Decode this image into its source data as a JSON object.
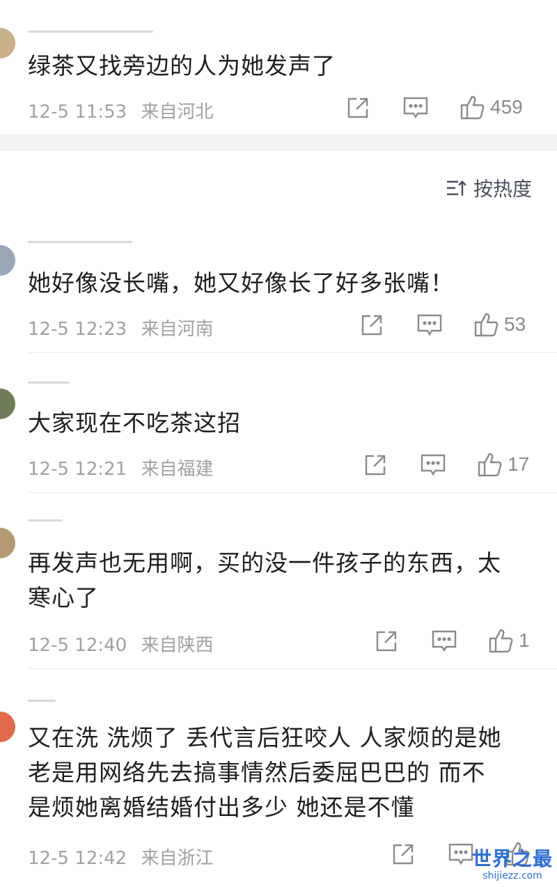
{
  "sort": {
    "label": "按热度"
  },
  "comments": [
    {
      "text": "绿茶又找旁边的人为她发声了",
      "date": "12-5",
      "time": "11:53",
      "region": "来自河北",
      "likes": "459"
    },
    {
      "text": "她好像没长嘴，她又好像长了好多张嘴！",
      "date": "12-5",
      "time": "12:23",
      "region": "来自河南",
      "likes": "53"
    },
    {
      "text": "大家现在不吃茶这招",
      "date": "12-5",
      "time": "12:21",
      "region": "来自福建",
      "likes": "17"
    },
    {
      "text": "再发声也无用啊，买的没一件孩子的东西，太\n寒心了",
      "date": "12-5",
      "time": "12:40",
      "region": "来自陕西",
      "likes": "1"
    },
    {
      "text": "又在洗 洗烦了 丢代言后狂咬人 人家烦的是她\n老是用网络先去搞事情然后委屈巴巴的 而不\n是烦她离婚结婚付出多少 她还是不懂",
      "date": "12-5",
      "time": "12:42",
      "region": "来自浙江",
      "likes": ""
    }
  ],
  "watermark": {
    "title": "世界之最",
    "url": "shijiezz.com"
  },
  "colors": {
    "text": "#1e1e1e",
    "meta": "#a0a0a0",
    "icon": "#8a8a8a",
    "watermark": "#2c6fd6"
  }
}
